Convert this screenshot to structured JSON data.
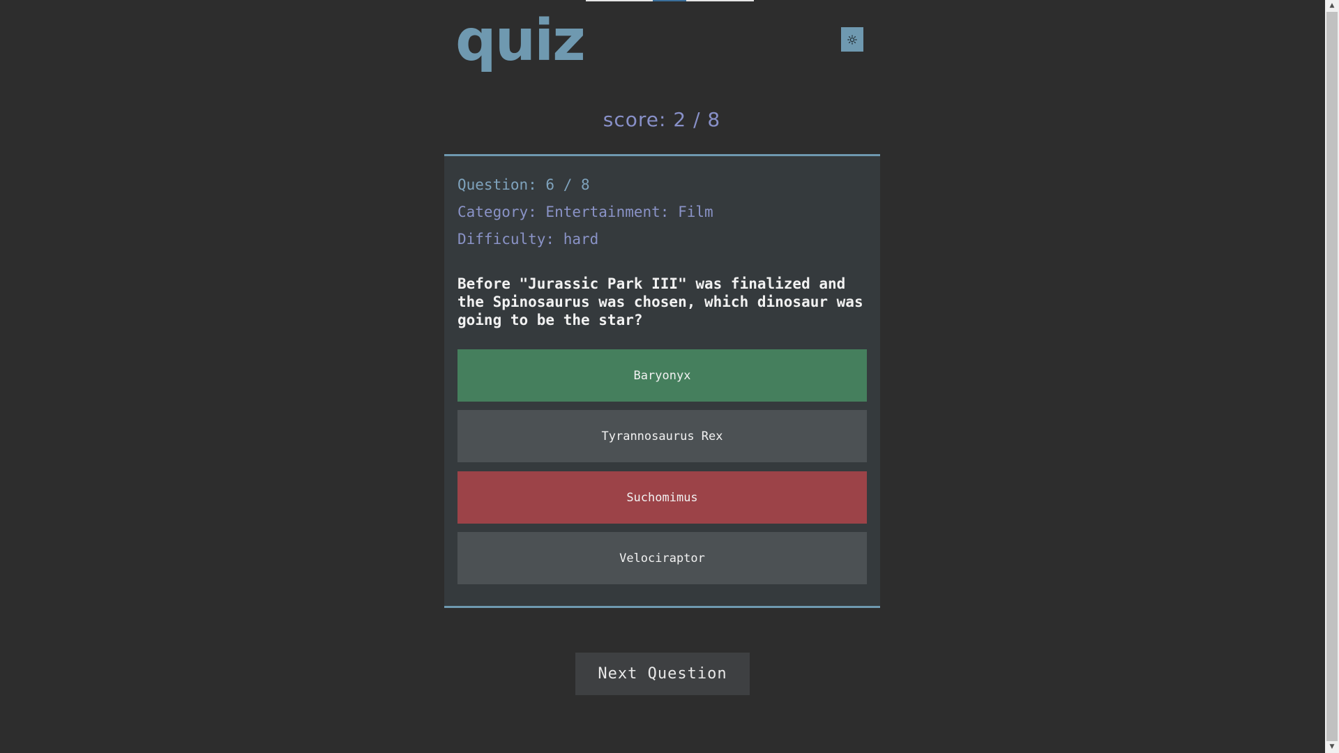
{
  "app": {
    "logo": "quiz",
    "theme_toggle_icon": "sun-icon"
  },
  "score": {
    "text": "score: 2 / 8"
  },
  "question": {
    "number_text": "Question: 6 / 8",
    "category_text": "Category: Entertainment: Film",
    "difficulty_text": "Difficulty: hard",
    "text": "Before \"Jurassic Park III\" was finalized and the Spinosaurus was chosen, which dinosaur was going to be the star?"
  },
  "answers": [
    {
      "label": "Baryonyx",
      "state": "correct"
    },
    {
      "label": "Tyrannosaurus Rex",
      "state": "neutral"
    },
    {
      "label": "Suchomimus",
      "state": "wrong"
    },
    {
      "label": "Velociraptor",
      "state": "neutral"
    }
  ],
  "next_button": {
    "label": "Next Question"
  },
  "colors": {
    "background": "#2d2d2d",
    "accent": "#6f99b0",
    "card": "#353a3d",
    "correct": "#457f5d",
    "wrong": "#9c4348",
    "neutral": "#4c5154"
  }
}
